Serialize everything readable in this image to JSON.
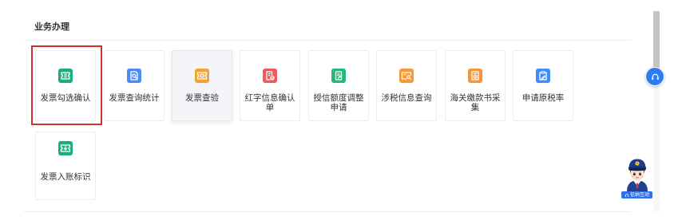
{
  "section": {
    "title": "业务办理"
  },
  "tiles": [
    {
      "label": "发票勾选确认",
      "icon": "ticket-icon",
      "color": "#1bae7b"
    },
    {
      "label": "发票查询统计",
      "icon": "document-search-icon",
      "color": "#4a8cf5"
    },
    {
      "label": "发票查验",
      "icon": "ticket-check-icon",
      "color": "#f5a030"
    },
    {
      "label": "红字信息确认单",
      "icon": "document-check-icon",
      "color": "#f05a5a"
    },
    {
      "label": "授信额度调整申请",
      "icon": "document-edit-icon",
      "color": "#22b97a"
    },
    {
      "label": "涉税信息查询",
      "icon": "card-search-icon",
      "color": "#f79a35"
    },
    {
      "label": "海关缴款书采集",
      "icon": "document-coin-icon",
      "color": "#f7953a"
    },
    {
      "label": "申请原税率",
      "icon": "clipboard-edit-icon",
      "color": "#3f8cf7"
    },
    {
      "label": "发票入账标识",
      "icon": "ticket-download-icon",
      "color": "#1bae7b"
    }
  ],
  "support_button": {
    "icon": "headset-icon",
    "color": "#2f7cf0"
  },
  "assistant": {
    "label": "征纳互动",
    "icon": "headset-icon",
    "avatar": "tax-officer-avatar-icon",
    "color": "#2f6fe8"
  },
  "colors": {
    "selection_outline": "#d0312d",
    "text": "#333333",
    "border": "#ededed"
  }
}
